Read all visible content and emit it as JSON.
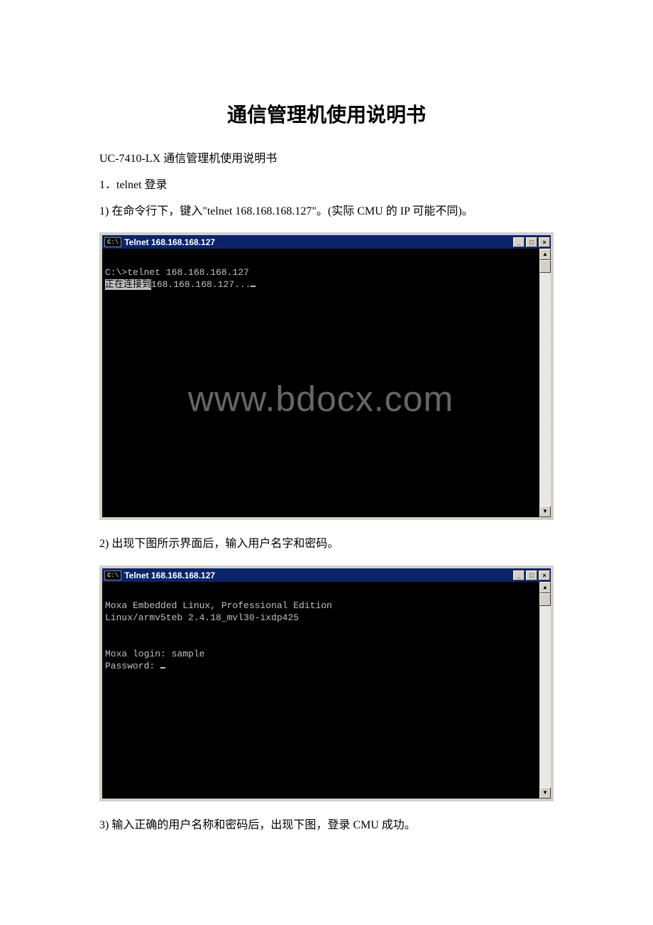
{
  "doc": {
    "title": "通信管理机使用说明书",
    "subtitle": "UC-7410-LX 通信管理机使用说明书",
    "section": "1．telnet 登录",
    "step1": "1) 在命令行下，键入\"telnet 168.168.168.127\"。(实际 CMU 的 IP 可能不同)。",
    "step2": "2) 出现下图所示界面后，输入用户名字和密码。",
    "step3": "3) 输入正确的用户名称和密码后，出现下图，登录 CMU 成功。"
  },
  "window": {
    "icon_label": "C:\\",
    "title": "Telnet 168.168.168.127",
    "minimize": "_",
    "maximize": "□",
    "close": "×",
    "scroll_up": "▲",
    "scroll_down": "▼"
  },
  "terminal1": {
    "line1": "C:\\>telnet 168.168.168.127",
    "line2_pre": "正在连接到",
    "line2_ip": "168.168.168.127...",
    "watermark": "www.bdocx.com"
  },
  "terminal2": {
    "line1": "Moxa Embedded Linux, Professional Edition",
    "line2": "Linux/armv5teb 2.4.18_mvl30-ixdp425",
    "line3": "Moxa login: sample",
    "line4": "Password: "
  }
}
